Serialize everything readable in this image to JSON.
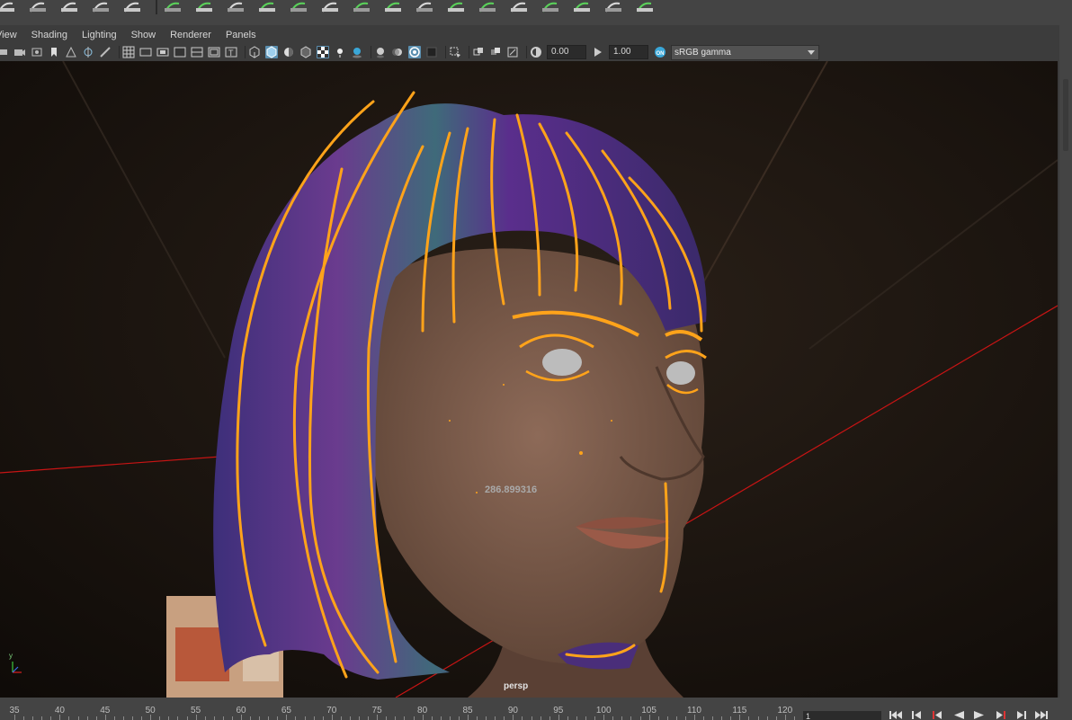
{
  "shelf": {
    "icons": [
      "curve-tool-icon",
      "curve-edit-icon",
      "curve-edit-icon",
      "curve-edit-icon",
      "curve-edit-icon",
      "modify-curve-icon",
      "hair-system-icon",
      "hair-system-icon",
      "hair-system-icon",
      "hair-system-icon",
      "hair-system-icon",
      "hair-system-icon",
      "hair-system-icon",
      "hair-system-icon",
      "hair-system-icon",
      "hair-system-icon",
      "hair-system-icon",
      "hair-system-icon",
      "hair-system-icon",
      "hair-system-icon",
      "hair-system-icon"
    ]
  },
  "panel_menu": {
    "items": [
      "View",
      "Shading",
      "Lighting",
      "Show",
      "Renderer",
      "Panels"
    ]
  },
  "toolbar": {
    "exposure": "0.00",
    "gamma": "1.00",
    "color_space": "sRGB gamma"
  },
  "viewport": {
    "hud_value": "286.899316",
    "camera_name": "persp",
    "axis_label": "y"
  },
  "timeslider": {
    "ticks": [
      "35",
      "40",
      "45",
      "50",
      "55",
      "60",
      "65",
      "70",
      "75",
      "80",
      "85",
      "90",
      "95",
      "100",
      "105",
      "110",
      "115",
      "120"
    ],
    "current_frame": "1"
  },
  "colors": {
    "guide_curves": "#ffa31a",
    "hair_purple": "#5a2e8c",
    "skin": "#7a5a4a",
    "background": "#1a1410",
    "active_button": "#5a8fb0",
    "axis_line": "#c81414"
  }
}
